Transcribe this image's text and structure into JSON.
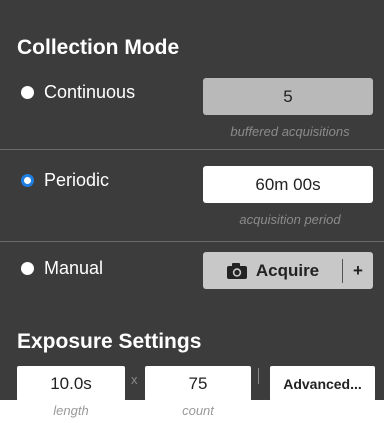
{
  "collection": {
    "title": "Collection Mode",
    "continuous": {
      "label": "Continuous",
      "value": "5",
      "hint": "buffered acquisitions",
      "selected": false
    },
    "periodic": {
      "label": "Periodic",
      "value": "60m 00s",
      "hint": "acquisition period",
      "selected": true
    },
    "manual": {
      "label": "Manual",
      "acquire_label": "Acquire",
      "plus_label": "+",
      "selected": false
    }
  },
  "exposure": {
    "title": "Exposure Settings",
    "length_value": "10.0s",
    "length_hint": "length",
    "times_symbol": "x",
    "count_value": "75",
    "count_hint": "count",
    "advanced_label": "Advanced..."
  },
  "colors": {
    "panel_bg": "#3c3c3c",
    "radio_selected": "#1f7ee0",
    "disabled_field": "#b9b9b9"
  },
  "icons": {
    "acquire": "camera-icon"
  }
}
